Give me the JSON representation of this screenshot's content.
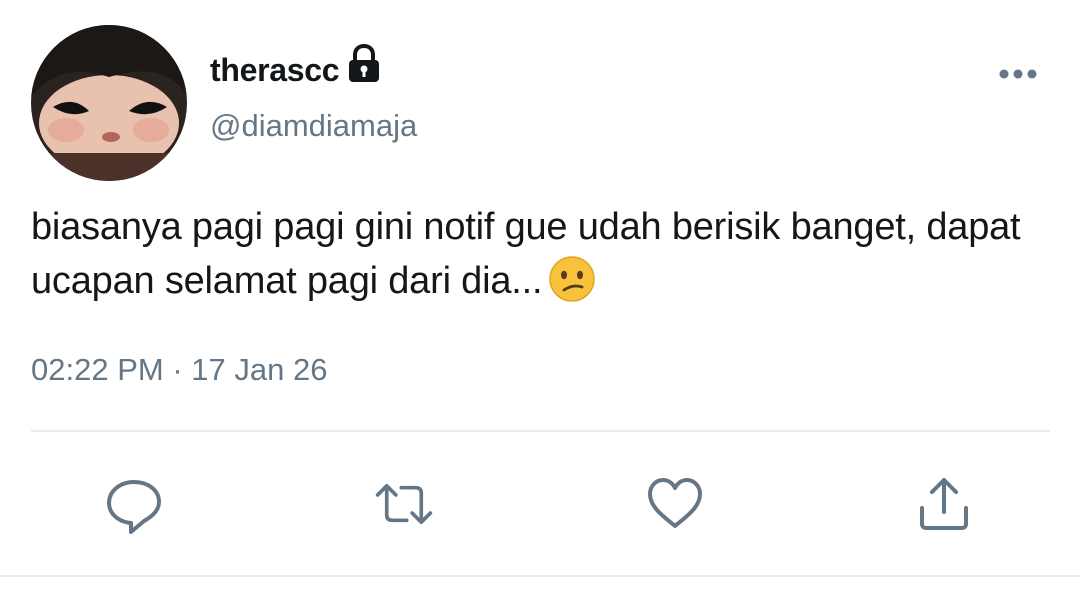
{
  "tweet": {
    "display_name": "therascc",
    "handle": "@diamdiamaja",
    "text": "biasanya pagi pagi gini notif gue udah berisik banget, dapat ucapan selamat pagi dari dia...",
    "emoji": "confused-face",
    "time": "02:22 PM",
    "separator": "·",
    "date": "17 Jan 26",
    "protected": true
  },
  "actions": {
    "reply": "reply-icon",
    "retweet": "retweet-icon",
    "like": "heart-icon",
    "share": "share-icon"
  },
  "colors": {
    "text": "#14171a",
    "secondary": "#657786",
    "divider": "#e6ecf0",
    "emoji_face": "#f9c23c"
  }
}
